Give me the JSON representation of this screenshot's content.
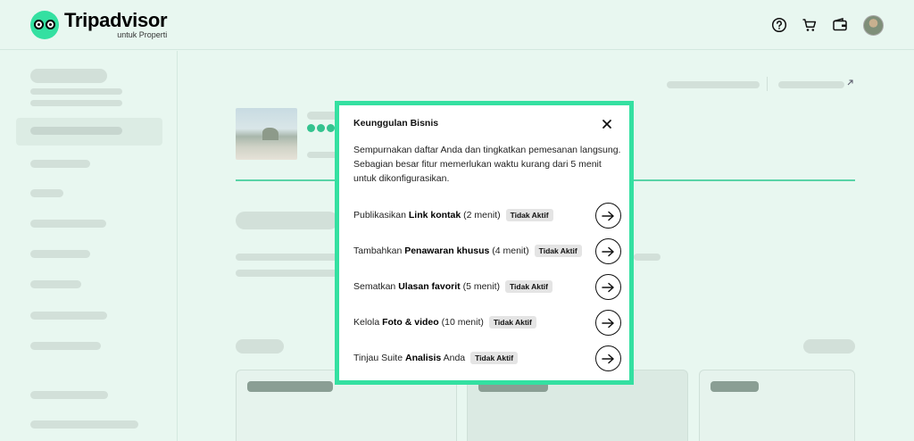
{
  "header": {
    "brand": "Tripadvisor",
    "brand_sub": "untuk Properti",
    "icons": [
      "help-icon",
      "cart-icon",
      "wallet-icon",
      "avatar"
    ]
  },
  "colors": {
    "brand": "#34e0a1",
    "background": "#e8f7f0",
    "skeleton": "#d2e0d9"
  },
  "modal": {
    "title": "Keunggulan Bisnis",
    "description": "Sempurnakan daftar Anda dan tingkatkan pemesanan langsung. Sebagian besar fitur memerlukan waktu kurang dari 5 menit untuk dikonfigurasikan.",
    "tasks": [
      {
        "prefix": "Publikasikan ",
        "bold": "Link kontak",
        "suffix": " (2 menit)",
        "status": "Tidak Aktif"
      },
      {
        "prefix": "Tambahkan ",
        "bold": "Penawaran khusus",
        "suffix": " (4 menit)",
        "status": "Tidak Aktif"
      },
      {
        "prefix": "Sematkan ",
        "bold": "Ulasan favorit",
        "suffix": " (5 menit)",
        "status": "Tidak Aktif"
      },
      {
        "prefix": "Kelola ",
        "bold": "Foto & video",
        "suffix": " (10 menit)",
        "status": "Tidak Aktif"
      },
      {
        "prefix": "Tinjau Suite ",
        "bold": "Analisis",
        "suffix": " Anda",
        "status": "Tidak Aktif"
      }
    ]
  }
}
